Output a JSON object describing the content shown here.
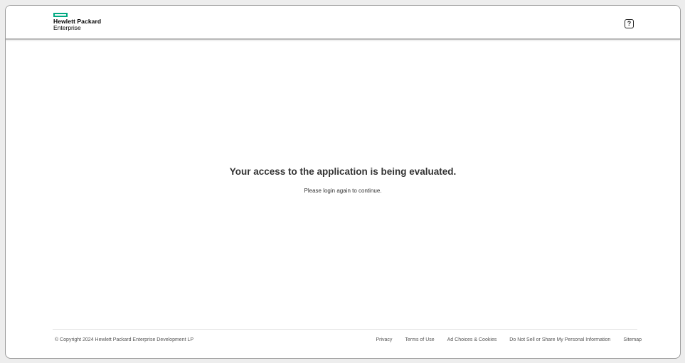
{
  "header": {
    "logo_line1": "Hewlett Packard",
    "logo_line2": "Enterprise",
    "help_icon": "help-question-icon",
    "help_glyph": "?"
  },
  "main": {
    "title": "Your access to the application is being evaluated.",
    "subtitle": "Please login again to continue."
  },
  "footer": {
    "copyright": "© Copyright 2024 Hewlett Packard Enterprise Development LP",
    "links": [
      "Privacy",
      "Terms of Use",
      "Ad Choices & Cookies",
      "Do Not Sell or Share My Personal Information",
      "Sitemap"
    ]
  },
  "colors": {
    "brand_green": "#01a982",
    "text": "#333333",
    "header_border": "#b9b9b9"
  }
}
